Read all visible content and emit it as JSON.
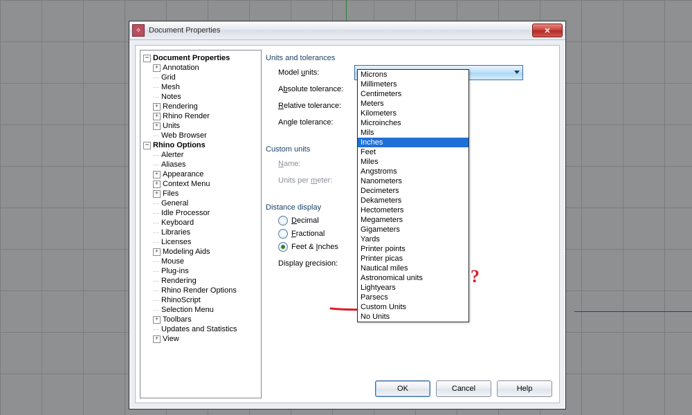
{
  "dialog_title": "Document Properties",
  "tree": {
    "roots": [
      {
        "label": "Document Properties",
        "children": [
          {
            "label": "Annotation",
            "tw": "+"
          },
          {
            "label": "Grid",
            "tw": ""
          },
          {
            "label": "Mesh",
            "tw": ""
          },
          {
            "label": "Notes",
            "tw": ""
          },
          {
            "label": "Rendering",
            "tw": "+"
          },
          {
            "label": "Rhino Render",
            "tw": "+"
          },
          {
            "label": "Units",
            "tw": "+"
          },
          {
            "label": "Web Browser",
            "tw": ""
          }
        ]
      },
      {
        "label": "Rhino Options",
        "children": [
          {
            "label": "Alerter",
            "tw": ""
          },
          {
            "label": "Aliases",
            "tw": ""
          },
          {
            "label": "Appearance",
            "tw": "+"
          },
          {
            "label": "Context Menu",
            "tw": "+"
          },
          {
            "label": "Files",
            "tw": "+"
          },
          {
            "label": "General",
            "tw": ""
          },
          {
            "label": "Idle Processor",
            "tw": ""
          },
          {
            "label": "Keyboard",
            "tw": ""
          },
          {
            "label": "Libraries",
            "tw": ""
          },
          {
            "label": "Licenses",
            "tw": ""
          },
          {
            "label": "Modeling Aids",
            "tw": "+"
          },
          {
            "label": "Mouse",
            "tw": ""
          },
          {
            "label": "Plug-ins",
            "tw": ""
          },
          {
            "label": "Rendering",
            "tw": ""
          },
          {
            "label": "Rhino Render Options",
            "tw": ""
          },
          {
            "label": "RhinoScript",
            "tw": ""
          },
          {
            "label": "Selection Menu",
            "tw": ""
          },
          {
            "label": "Toolbars",
            "tw": "+"
          },
          {
            "label": "Updates and Statistics",
            "tw": ""
          },
          {
            "label": "View",
            "tw": "+"
          }
        ]
      }
    ]
  },
  "groups": {
    "units": "Units and tolerances",
    "custom": "Custom units",
    "dist": "Distance display"
  },
  "labels": {
    "model_units_pre": "Model ",
    "model_units_u": "u",
    "model_units_post": "nits:",
    "abs_pre": "A",
    "abs_u": "b",
    "abs_post": "solute tolerance:",
    "rel_u": "R",
    "rel_post": "elative tolerance:",
    "ang_pre": "An",
    "ang_u": "g",
    "ang_post": "le tolerance:",
    "name_u": "N",
    "name_post": "ame:",
    "upm": "Units per ",
    "upm_u": "m",
    "upm_post": "eter:",
    "dec_u": "D",
    "dec_post": "ecimal",
    "frac_u": "F",
    "frac_post": "ractional",
    "feet": "Feet & ",
    "feet_u": "I",
    "feet_post": "nches",
    "disp": "Display ",
    "disp_u": "p",
    "disp_post": "recision:"
  },
  "combo_value": "Inches",
  "dropdown_items": [
    "Microns",
    "Millimeters",
    "Centimeters",
    "Meters",
    "Kilometers",
    "Microinches",
    "Mils",
    "Inches",
    "Feet",
    "Miles",
    "Angstroms",
    "Nanometers",
    "Decimeters",
    "Dekameters",
    "Hectometers",
    "Megameters",
    "Gigameters",
    "Yards",
    "Printer points",
    "Printer picas",
    "Nautical miles",
    "Astronomical units",
    "Lightyears",
    "Parsecs",
    "Custom Units",
    "No Units"
  ],
  "dropdown_selected_index": 7,
  "buttons": {
    "ok": "OK",
    "cancel": "Cancel",
    "help": "Help"
  },
  "annotation_color": "#d81f2a"
}
